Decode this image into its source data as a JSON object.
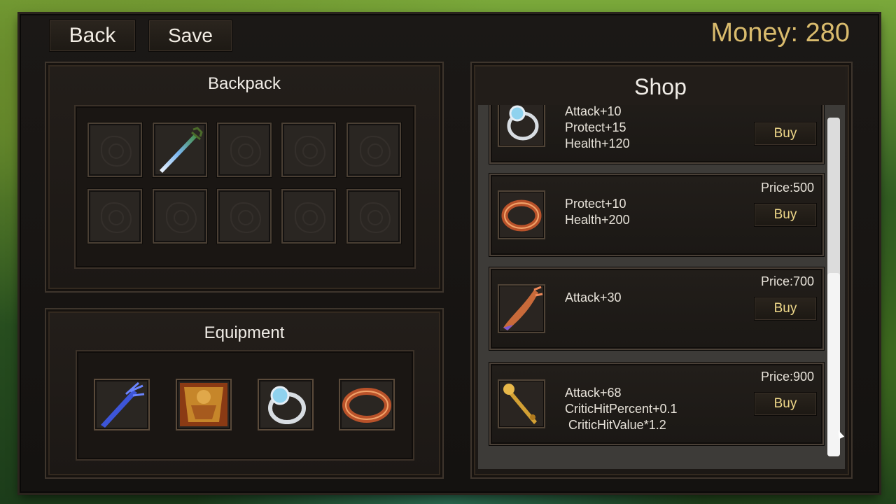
{
  "header": {
    "back_label": "Back",
    "save_label": "Save",
    "money_text": "Money: 280"
  },
  "backpack": {
    "title": "Backpack",
    "slots": [
      "empty",
      "blue-sword",
      "empty",
      "empty",
      "empty",
      "empty",
      "empty",
      "empty",
      "empty",
      "empty"
    ]
  },
  "equipment": {
    "title": "Equipment",
    "slots": [
      "sword-icon",
      "armor-icon",
      "ring-icon",
      "bracelet-icon"
    ]
  },
  "shop": {
    "title": "Shop",
    "items": [
      {
        "icon": "ring-icon",
        "stats": "Attack+10\nProtect+15\nHealth+120",
        "price": "",
        "buy_label": "Buy"
      },
      {
        "icon": "bracelet-icon",
        "stats": "Protect+10\nHealth+200",
        "price": "Price:500",
        "buy_label": "Buy"
      },
      {
        "icon": "claw-weapon-icon",
        "stats": "Attack+30",
        "price": "Price:700",
        "buy_label": "Buy"
      },
      {
        "icon": "golden-staff-icon",
        "stats": "Attack+68\nCriticHitPercent+0.1\n CriticHitValue*1.2",
        "price": "Price:900",
        "buy_label": "Buy"
      }
    ]
  },
  "colors": {
    "money": "#d9bb6d",
    "buy_text": "#f0d98a",
    "panel_bg": "#1c1815"
  }
}
